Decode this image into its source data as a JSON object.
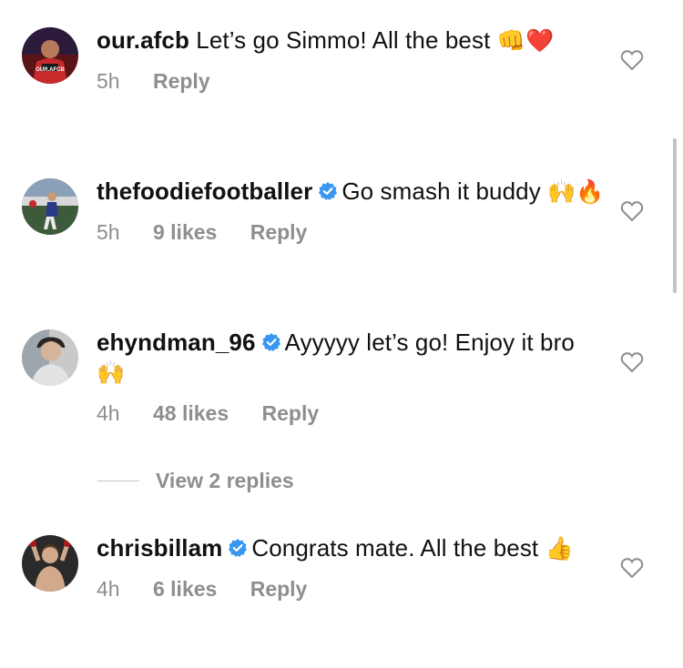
{
  "comments": [
    {
      "username": "our.afcb",
      "verified": false,
      "text": "Let’s go Simmo! All the best",
      "emojis": "👊❤️",
      "time": "5h",
      "likes": "",
      "reply": "Reply",
      "avatar_caption": "OUR.AFCB"
    },
    {
      "username": "thefoodiefootballer",
      "verified": true,
      "text": "Go smash it buddy",
      "emojis": "🙌🔥",
      "time": "5h",
      "likes": "9 likes",
      "reply": "Reply"
    },
    {
      "username": "ehyndman_96",
      "verified": true,
      "text": "Ayyyyy let’s go! Enjoy it bro",
      "emojis": "🙌",
      "time": "4h",
      "likes": "48 likes",
      "reply": "Reply"
    },
    {
      "username": "chrisbillam",
      "verified": true,
      "text": "Congrats mate. All the best",
      "emojis": "👍",
      "time": "4h",
      "likes": "6 likes",
      "reply": "Reply"
    }
  ],
  "view_replies_label": "View 2 replies",
  "icons": {
    "like": "heart-outline-icon",
    "verified": "verified-badge-icon"
  },
  "colors": {
    "verified_blue": "#3897f0",
    "secondary_text": "#8e8e8e"
  }
}
